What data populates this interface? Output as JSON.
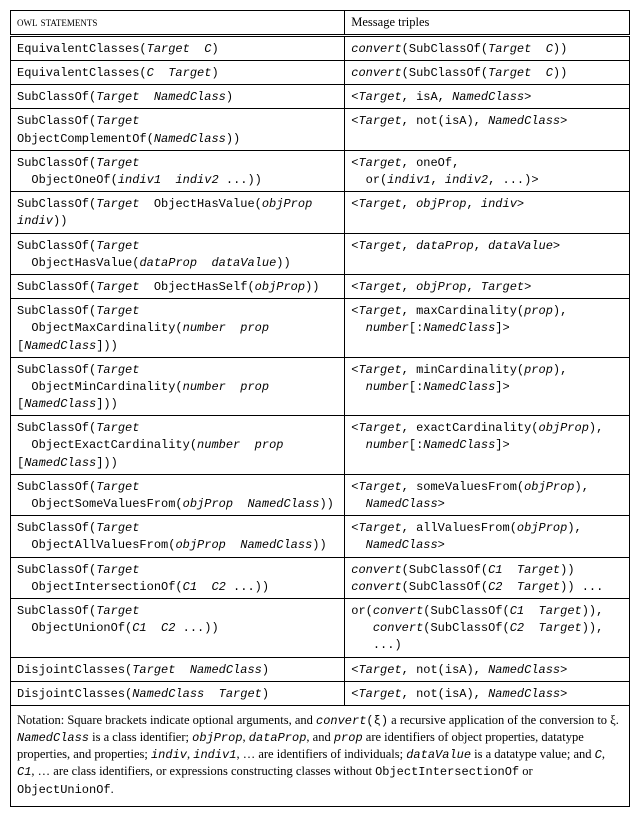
{
  "header": {
    "col1": "owl statements",
    "col2": "Message triples"
  },
  "rows": [
    {
      "l": "EquivalentClasses(<i>Target</i>  <i>C</i>)",
      "r": "<i>convert</i>(SubClassOf(<i>Target</i>  <i>C</i>))"
    },
    {
      "l": "EquivalentClasses(<i>C</i>  <i>Target</i>)",
      "r": "<i>convert</i>(SubClassOf(<i>Target</i>  <i>C</i>))"
    },
    {
      "l": "SubClassOf(<i>Target</i>  <i>NamedClass</i>)",
      "r": "&lt;<i>Target</i>, isA, <i>NamedClass</i>&gt;"
    },
    {
      "l": "SubClassOf(<i>Target</i>  ObjectComplementOf(<i>NamedClass</i>))",
      "r": "&lt;<i>Target</i>, not(isA), <i>NamedClass</i>&gt;"
    },
    {
      "l": "SubClassOf(<i>Target</i>\n  ObjectOneOf(<i>indiv1</i>  <i>indiv2</i> ...))",
      "r": "&lt;<i>Target</i>, oneOf,\n  or(<i>indiv1</i>, <i>indiv2</i>, ...)&gt;"
    },
    {
      "l": "SubClassOf(<i>Target</i>  ObjectHasValue(<i>objProp</i>  <i>indiv</i>))",
      "r": "&lt;<i>Target</i>, <i>objProp</i>, <i>indiv</i>&gt;"
    },
    {
      "l": "SubClassOf(<i>Target</i>\n  ObjectHasValue(<i>dataProp</i>  <i>dataValue</i>))",
      "r": "&lt;<i>Target</i>, <i>dataProp</i>, <i>dataValue</i>&gt;"
    },
    {
      "l": "SubClassOf(<i>Target</i>  ObjectHasSelf(<i>objProp</i>))",
      "r": "&lt;<i>Target</i>, <i>objProp</i>, <i>Target</i>&gt;"
    },
    {
      "l": "SubClassOf(<i>Target</i>\n  ObjectMaxCardinality(<i>number</i>  <i>prop</i> [<i>NamedClass</i>]))",
      "r": "&lt;<i>Target</i>, maxCardinality(<i>prop</i>),\n  <i>number</i>[:<i>NamedClass</i>]&gt;"
    },
    {
      "l": "SubClassOf(<i>Target</i>\n  ObjectMinCardinality(<i>number</i>  <i>prop</i> [<i>NamedClass</i>]))",
      "r": "&lt;<i>Target</i>, minCardinality(<i>prop</i>),\n  <i>number</i>[:<i>NamedClass</i>]&gt;"
    },
    {
      "l": "SubClassOf(<i>Target</i>\n  ObjectExactCardinality(<i>number</i>  <i>prop</i> [<i>NamedClass</i>]))",
      "r": "&lt;<i>Target</i>, exactCardinality(<i>objProp</i>),\n  <i>number</i>[:<i>NamedClass</i>]&gt;"
    },
    {
      "l": "SubClassOf(<i>Target</i>\n  ObjectSomeValuesFrom(<i>objProp</i>  <i>NamedClass</i>))",
      "r": "&lt;<i>Target</i>, someValuesFrom(<i>objProp</i>),\n  <i>NamedClass</i>&gt;"
    },
    {
      "l": "SubClassOf(<i>Target</i>\n  ObjectAllValuesFrom(<i>objProp</i>  <i>NamedClass</i>))",
      "r": "&lt;<i>Target</i>, allValuesFrom(<i>objProp</i>),\n  <i>NamedClass</i>&gt;"
    },
    {
      "l": "SubClassOf(<i>Target</i>\n  ObjectIntersectionOf(<i>C1</i>  <i>C2</i> ...))",
      "r": "<i>convert</i>(SubClassOf(<i>C1</i>  <i>Target</i>))\n<i>convert</i>(SubClassOf(<i>C2</i>  <i>Target</i>)) ..."
    },
    {
      "l": "SubClassOf(<i>Target</i>\n  ObjectUnionOf(<i>C1</i>  <i>C2</i> ...))",
      "r": "or(<i>convert</i>(SubClassOf(<i>C1</i>  <i>Target</i>)),\n   <i>convert</i>(SubClassOf(<i>C2</i>  <i>Target</i>)),\n   ...)"
    },
    {
      "l": "DisjointClasses(<i>Target</i>  <i>NamedClass</i>)",
      "r": "&lt;<i>Target</i>, not(isA), <i>NamedClass</i>&gt;"
    },
    {
      "l": "DisjointClasses(<i>NamedClass</i>  <i>Target</i>)",
      "r": "&lt;<i>Target</i>, not(isA), <i>NamedClass</i>&gt;"
    }
  ],
  "notation": "Notation: Square brackets indicate optional arguments, and <span class=\"ital\">convert</span><span class=\"mono\">(ξ)</span> a recursive application of the conversion to ξ. <span class=\"ital\">NamedClass</span> is a class identifier; <span class=\"ital\">objProp</span>, <span class=\"ital\">dataProp</span>, and <span class=\"ital\">prop</span> are identifiers of object properties, datatype properties, and properties; <span class=\"ital\">indiv</span>, <span class=\"ital\">indiv1</span>, … are identifiers of individuals; <span class=\"ital\">dataValue</span> is a datatype value; and <span class=\"ital\">C</span>, <span class=\"ital\">C1</span>, … are class identifiers, or expressions constructing classes without <span class=\"mono\">ObjectIntersectionOf</span> or <span class=\"mono\">ObjectUnionOf</span>."
}
